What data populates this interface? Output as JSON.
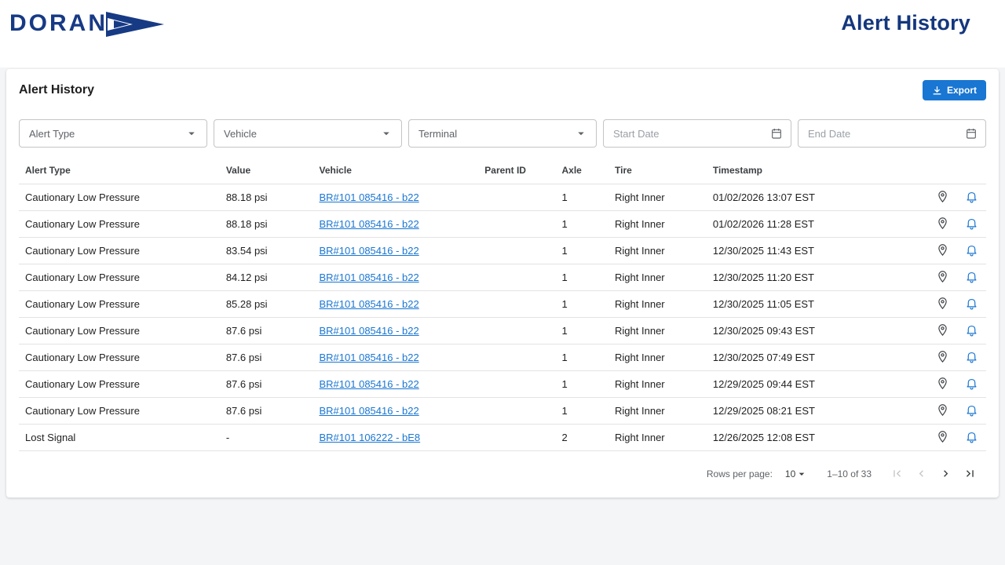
{
  "header": {
    "logo_text": "DORAN",
    "page_title": "Alert History"
  },
  "panel": {
    "title": "Alert History",
    "export_label": "Export"
  },
  "filters": [
    {
      "label": "Alert Type",
      "type": "select"
    },
    {
      "label": "Vehicle",
      "type": "select"
    },
    {
      "label": "Terminal",
      "type": "select"
    },
    {
      "label": "Start Date",
      "type": "date"
    },
    {
      "label": "End Date",
      "type": "date"
    }
  ],
  "table": {
    "columns": [
      "Alert Type",
      "Value",
      "Vehicle",
      "Parent ID",
      "Axle",
      "Tire",
      "Timestamp"
    ],
    "rows": [
      {
        "alert_type": "Cautionary Low Pressure",
        "value": "88.18 psi",
        "vehicle": "BR#101 085416 - b22",
        "parent_id": "",
        "axle": "1",
        "tire": "Right Inner",
        "timestamp": "01/02/2026 13:07 EST"
      },
      {
        "alert_type": "Cautionary Low Pressure",
        "value": "88.18 psi",
        "vehicle": "BR#101 085416 - b22",
        "parent_id": "",
        "axle": "1",
        "tire": "Right Inner",
        "timestamp": "01/02/2026 11:28 EST"
      },
      {
        "alert_type": "Cautionary Low Pressure",
        "value": "83.54 psi",
        "vehicle": "BR#101 085416 - b22",
        "parent_id": "",
        "axle": "1",
        "tire": "Right Inner",
        "timestamp": "12/30/2025 11:43 EST"
      },
      {
        "alert_type": "Cautionary Low Pressure",
        "value": "84.12 psi",
        "vehicle": "BR#101 085416 - b22",
        "parent_id": "",
        "axle": "1",
        "tire": "Right Inner",
        "timestamp": "12/30/2025 11:20 EST"
      },
      {
        "alert_type": "Cautionary Low Pressure",
        "value": "85.28 psi",
        "vehicle": "BR#101 085416 - b22",
        "parent_id": "",
        "axle": "1",
        "tire": "Right Inner",
        "timestamp": "12/30/2025 11:05 EST"
      },
      {
        "alert_type": "Cautionary Low Pressure",
        "value": "87.6 psi",
        "vehicle": "BR#101 085416 - b22",
        "parent_id": "",
        "axle": "1",
        "tire": "Right Inner",
        "timestamp": "12/30/2025 09:43 EST"
      },
      {
        "alert_type": "Cautionary Low Pressure",
        "value": "87.6 psi",
        "vehicle": "BR#101 085416 - b22",
        "parent_id": "",
        "axle": "1",
        "tire": "Right Inner",
        "timestamp": "12/30/2025 07:49 EST"
      },
      {
        "alert_type": "Cautionary Low Pressure",
        "value": "87.6 psi",
        "vehicle": "BR#101 085416 - b22",
        "parent_id": "",
        "axle": "1",
        "tire": "Right Inner",
        "timestamp": "12/29/2025 09:44 EST"
      },
      {
        "alert_type": "Cautionary Low Pressure",
        "value": "87.6 psi",
        "vehicle": "BR#101 085416 - b22",
        "parent_id": "",
        "axle": "1",
        "tire": "Right Inner",
        "timestamp": "12/29/2025 08:21 EST"
      },
      {
        "alert_type": "Lost Signal",
        "value": "-",
        "vehicle": "BR#101 106222 - bE8",
        "parent_id": "",
        "axle": "2",
        "tire": "Right Inner",
        "timestamp": "12/26/2025 12:08 EST"
      }
    ]
  },
  "pagination": {
    "rows_per_page_label": "Rows per page:",
    "rows_per_page_value": "10",
    "range_label": "1–10 of 33"
  },
  "colors": {
    "accent_blue": "#1976d2",
    "brand_navy": "#14377d",
    "link_blue": "#1976d2",
    "border_gray": "#e3e3e3"
  },
  "icons": {
    "export": "download-icon",
    "row_actions": [
      "location-pin-icon",
      "alert-bell-icon"
    ],
    "date": "calendar-icon",
    "select": "chevron-down-icon"
  }
}
